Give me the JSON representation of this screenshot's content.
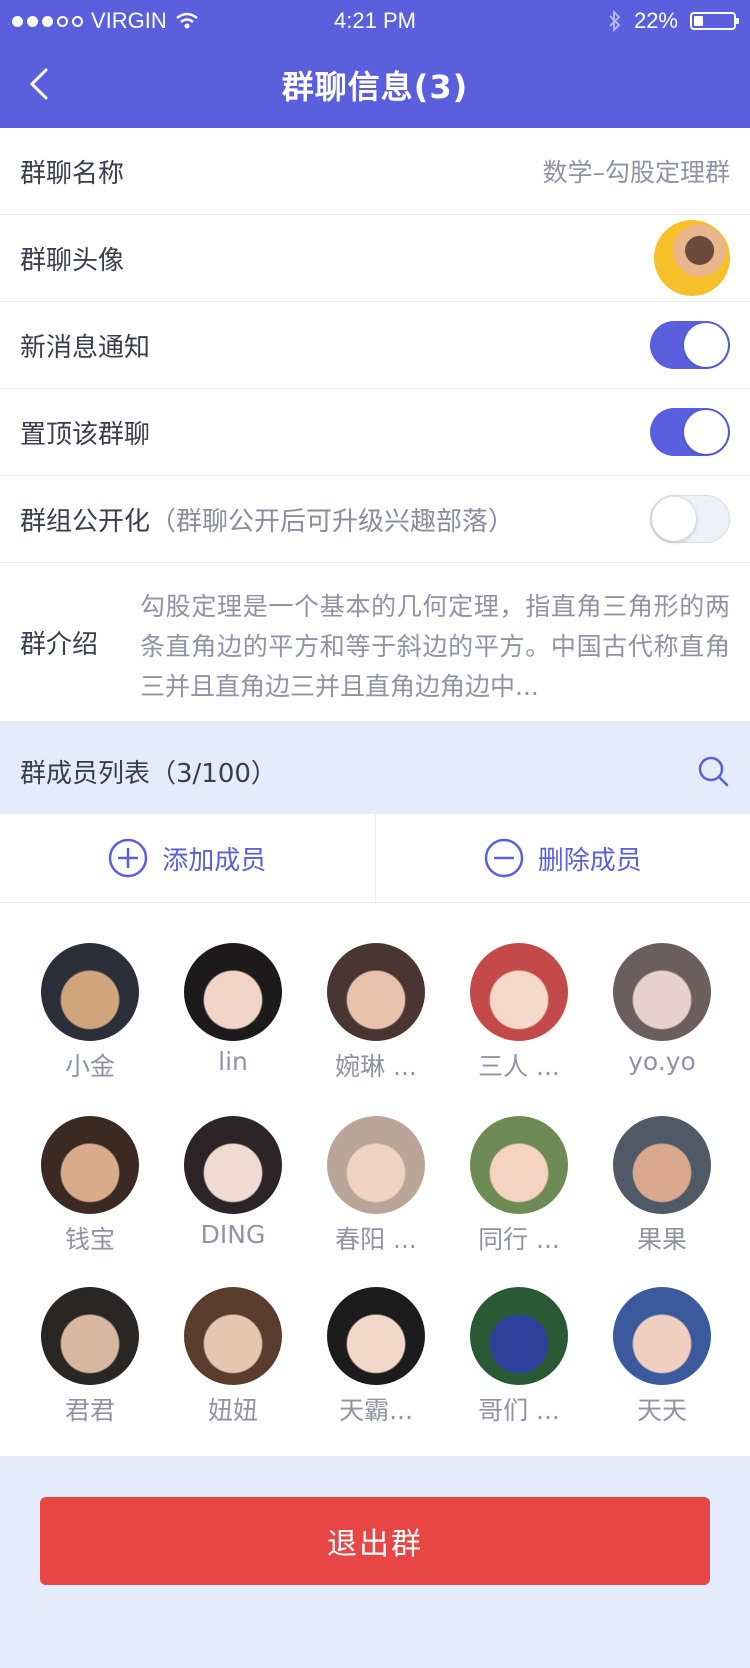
{
  "status_bar": {
    "carrier": "VIRGIN",
    "time": "4:21 PM",
    "battery": "22%"
  },
  "nav": {
    "title": "群聊信息(3)"
  },
  "settings": {
    "group_name_label": "群聊名称",
    "group_name_value": "数学–勾股定理群",
    "group_avatar_label": "群聊头像",
    "notify_label": "新消息通知",
    "notify_on": true,
    "pin_label": "置顶该群聊",
    "pin_on": true,
    "public_label": "群组公开化",
    "public_note": "（群聊公开后可升级兴趣部落）",
    "public_on": false,
    "intro_label": "群介绍",
    "intro_text": "勾股定理是一个基本的几何定理，指直角三角形的两条直角边的平方和等于斜边的平方。中国古代称直角三并且直角边三并且直角边角边中..."
  },
  "members_header": {
    "label": "群成员列表（3/100）"
  },
  "actions": {
    "add": "添加成员",
    "remove": "删除成员"
  },
  "members": [
    {
      "name": "小金",
      "colors": [
        "#2b2f3a",
        "#d1a57c"
      ]
    },
    {
      "name": "lin",
      "colors": [
        "#1d1a1c",
        "#f1d4c7"
      ]
    },
    {
      "name": "婉琳 ...",
      "colors": [
        "#4a3630",
        "#e8c2ad"
      ]
    },
    {
      "name": "三人 ...",
      "colors": [
        "#c44a4a",
        "#f4d8c9"
      ]
    },
    {
      "name": "yo.yo",
      "colors": [
        "#6b5e5c",
        "#e6d1cc"
      ]
    },
    {
      "name": "钱宝",
      "colors": [
        "#3a2a22",
        "#d9ab8a"
      ]
    },
    {
      "name": "DING",
      "colors": [
        "#2c2426",
        "#f0dbd3"
      ]
    },
    {
      "name": "春阳 ...",
      "colors": [
        "#b9a699",
        "#f1d3c2"
      ]
    },
    {
      "name": "同行 ...",
      "colors": [
        "#6f8b55",
        "#f4d3c0"
      ]
    },
    {
      "name": "果果",
      "colors": [
        "#4f5a66",
        "#d9a88d"
      ]
    },
    {
      "name": "君君",
      "colors": [
        "#2a2624",
        "#d8b7a0"
      ]
    },
    {
      "name": "妞妞",
      "colors": [
        "#5a3d2c",
        "#e7c6b0"
      ]
    },
    {
      "name": "天霸...",
      "colors": [
        "#1c1c1c",
        "#f3d7c9"
      ]
    },
    {
      "name": "哥们 ...",
      "colors": [
        "#2a5a35",
        "#2e3f9c"
      ]
    },
    {
      "name": "天天",
      "colors": [
        "#3b5a9e",
        "#f0cfc0"
      ]
    }
  ],
  "exit_button": {
    "label": "退出群",
    "color": "#e84545"
  },
  "theme": {
    "accent": "#5a5fdd",
    "page_bg": "#e4ebfb"
  }
}
